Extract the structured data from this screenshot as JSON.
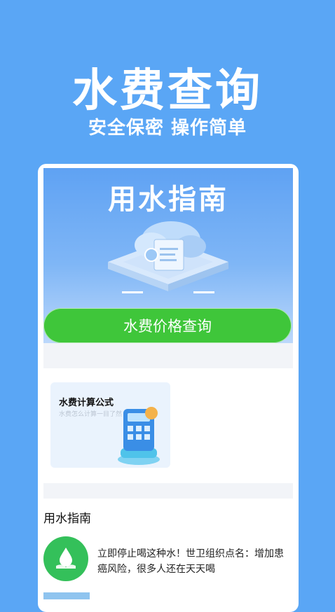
{
  "hero": {
    "title": "水费查询",
    "subtitle": "安全保密 操作简单"
  },
  "banner": {
    "title": "用水指南",
    "button_label": "水费价格查询"
  },
  "card": {
    "title": "水费计算公式",
    "desc": "水费怎么计算一目了然"
  },
  "section": {
    "title": "用水指南"
  },
  "news": {
    "items": [
      {
        "text": "立即停止喝这种水！世卫组织点名：增加患癌风险，很多人还在天天喝"
      }
    ]
  },
  "colors": {
    "background": "#5aa6f5",
    "button": "#3fc63a",
    "icon_bg": "#34c05a"
  }
}
